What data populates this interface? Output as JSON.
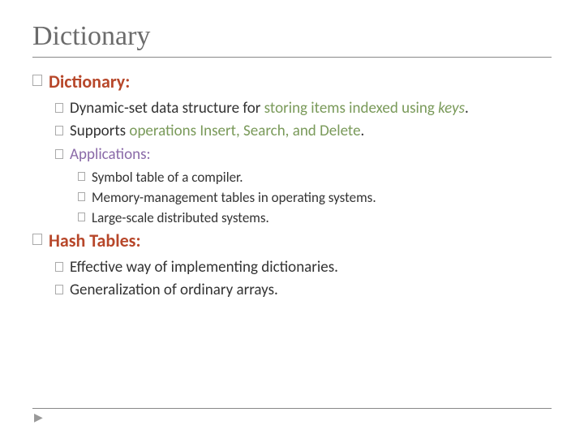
{
  "title": "Dictionary",
  "sections": [
    {
      "heading": "Dictionary:",
      "items": [
        {
          "pre": "Dynamic-set data structure for ",
          "green": "storing items indexed using ",
          "green_italic": "keys",
          "post": "."
        },
        {
          "pre": "Supports ",
          "green": "operations Insert, Search, and Delete",
          "post": "."
        },
        {
          "purple": "Applications:",
          "subitems": [
            "Symbol table of a compiler.",
            "Memory-management tables in operating systems.",
            "Large-scale distributed systems."
          ]
        }
      ]
    },
    {
      "heading": "Hash Tables:",
      "items": [
        {
          "pre": "Effective way of implementing dictionaries."
        },
        {
          "pre": "Generalization of ordinary arrays."
        }
      ]
    }
  ],
  "footer": {
    "arrow": "▶"
  }
}
